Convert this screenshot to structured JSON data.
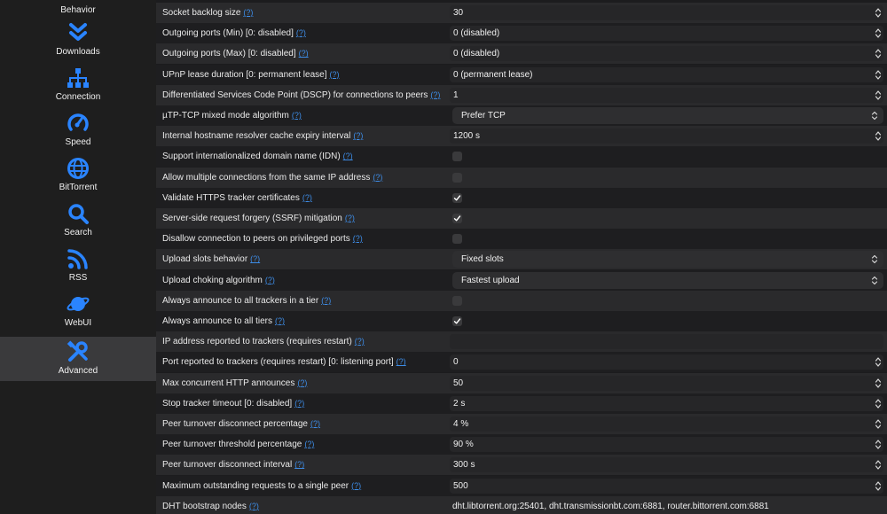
{
  "sidebar": {
    "items": [
      {
        "label": "Behavior",
        "icon": "behavior-icon"
      },
      {
        "label": "Downloads",
        "icon": "double-chevron-down-icon"
      },
      {
        "label": "Connection",
        "icon": "network-icon"
      },
      {
        "label": "Speed",
        "icon": "speedometer-icon"
      },
      {
        "label": "BitTorrent",
        "icon": "globe-icon"
      },
      {
        "label": "Search",
        "icon": "search-icon"
      },
      {
        "label": "RSS",
        "icon": "rss-icon"
      },
      {
        "label": "WebUI",
        "icon": "planet-icon"
      },
      {
        "label": "Advanced",
        "icon": "tools-icon"
      }
    ],
    "selected": "Advanced",
    "accent": "#2a84ff"
  },
  "settings": {
    "help_label": "(?)",
    "rows": [
      {
        "label": "Socket backlog size",
        "type": "spin",
        "value": "30"
      },
      {
        "label": "Outgoing ports (Min) [0: disabled]",
        "type": "spin",
        "value": "0 (disabled)"
      },
      {
        "label": "Outgoing ports (Max) [0: disabled]",
        "type": "spin",
        "value": "0 (disabled)"
      },
      {
        "label": "UPnP lease duration [0: permanent lease]",
        "type": "spin",
        "value": "0 (permanent lease)"
      },
      {
        "label": "Differentiated Services Code Point (DSCP) for connections to peers",
        "type": "spin",
        "value": "1"
      },
      {
        "label": "µTP-TCP mixed mode algorithm",
        "type": "select",
        "value": "Prefer TCP"
      },
      {
        "label": "Internal hostname resolver cache expiry interval",
        "type": "spin",
        "value": "1200 s"
      },
      {
        "label": "Support internationalized domain name (IDN)",
        "type": "check",
        "checked": false
      },
      {
        "label": "Allow multiple connections from the same IP address",
        "type": "check",
        "checked": false
      },
      {
        "label": "Validate HTTPS tracker certificates",
        "type": "check",
        "checked": true
      },
      {
        "label": "Server-side request forgery (SSRF) mitigation",
        "type": "check",
        "checked": true
      },
      {
        "label": "Disallow connection to peers on privileged ports",
        "type": "check",
        "checked": false
      },
      {
        "label": "Upload slots behavior",
        "type": "select",
        "value": "Fixed slots"
      },
      {
        "label": "Upload choking algorithm",
        "type": "select",
        "value": "Fastest upload"
      },
      {
        "label": "Always announce to all trackers in a tier",
        "type": "check",
        "checked": false
      },
      {
        "label": "Always announce to all tiers",
        "type": "check",
        "checked": true
      },
      {
        "label": "IP address reported to trackers (requires restart)",
        "type": "text",
        "value": ""
      },
      {
        "label": "Port reported to trackers (requires restart) [0: listening port]",
        "type": "spin",
        "value": "0"
      },
      {
        "label": "Max concurrent HTTP announces",
        "type": "spin",
        "value": "50"
      },
      {
        "label": "Stop tracker timeout [0: disabled]",
        "type": "spin",
        "value": "2 s"
      },
      {
        "label": "Peer turnover disconnect percentage",
        "type": "spin",
        "value": "4 %"
      },
      {
        "label": "Peer turnover threshold percentage",
        "type": "spin",
        "value": "90 %"
      },
      {
        "label": "Peer turnover disconnect interval",
        "type": "spin",
        "value": "300 s"
      },
      {
        "label": "Maximum outstanding requests to a single peer",
        "type": "spin",
        "value": "500"
      },
      {
        "label": "DHT bootstrap nodes",
        "type": "plain",
        "value": "dht.libtorrent.org:25401, dht.transmissionbt.com:6881, router.bittorrent.com:6881"
      }
    ]
  }
}
